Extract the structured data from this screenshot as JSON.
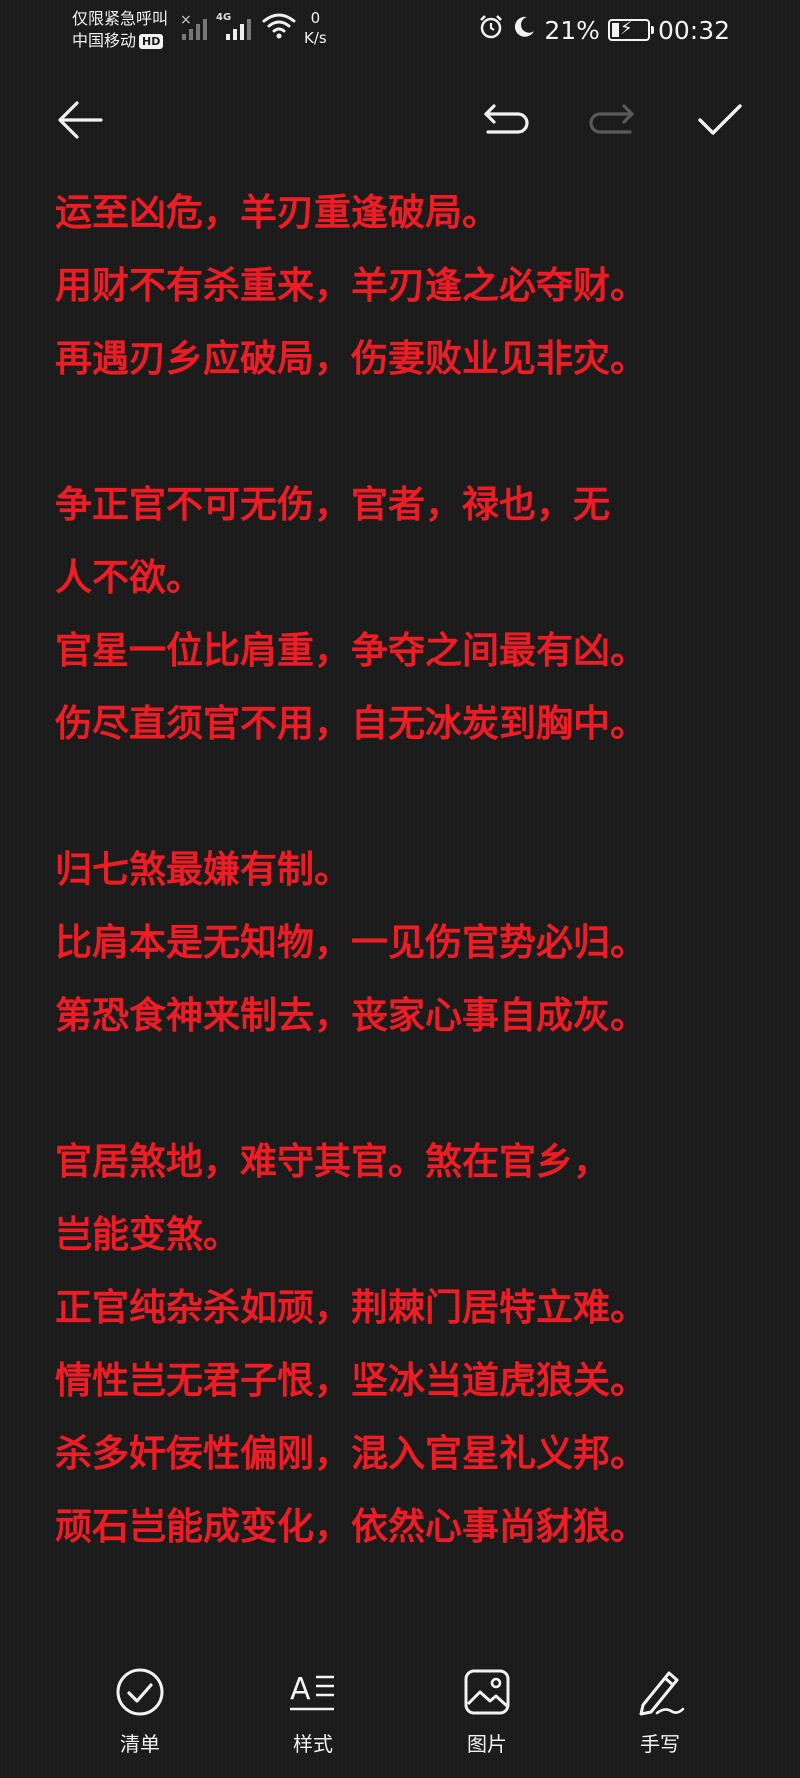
{
  "status_bar": {
    "carrier_line1": "仅限紧急呼叫",
    "carrier_line2": "中国移动",
    "hd_badge": "HD",
    "network_type": "4G",
    "speed_value": "0",
    "speed_unit": "K/s",
    "battery_percent": "21%",
    "time": "00:32"
  },
  "toolbar": {
    "back_icon": "arrow-left-icon",
    "undo_icon": "undo-icon",
    "redo_icon": "redo-icon",
    "confirm_icon": "checkmark-icon"
  },
  "note": {
    "paragraphs": [
      [
        "运至凶危，羊刃重逢破局。",
        "用财不有杀重来，羊刃逢之必夺财。",
        "再遇刃乡应破局，伤妻败业见非灾。"
      ],
      [
        "争正官不可无伤，官者，禄也，无",
        "人不欲。",
        "官星一位比肩重，争夺之间最有凶。",
        "伤尽直须官不用，自无冰炭到胸中。"
      ],
      [
        "归七煞最嫌有制。",
        "比肩本是无知物，一见伤官势必归。",
        "第恐食神来制去，丧家心事自成灰。"
      ],
      [
        "官居煞地，难守其官。煞在官乡，",
        "岂能变煞。",
        "正官纯杂杀如顽，荆棘门居特立难。",
        "情性岂无君子恨，坚冰当道虎狼关。",
        "杀多奸佞性偏刚，混入官星礼义邦。",
        "顽石岂能成变化，依然心事尚豺狼。"
      ]
    ]
  },
  "bottom_bar": {
    "checklist_label": "清单",
    "style_label": "样式",
    "image_label": "图片",
    "handwriting_label": "手写"
  },
  "colors": {
    "background": "#1b1b1b",
    "text": "#ee1c24",
    "icon": "#f2f2f2",
    "disabled_icon": "#5a5a5a"
  }
}
